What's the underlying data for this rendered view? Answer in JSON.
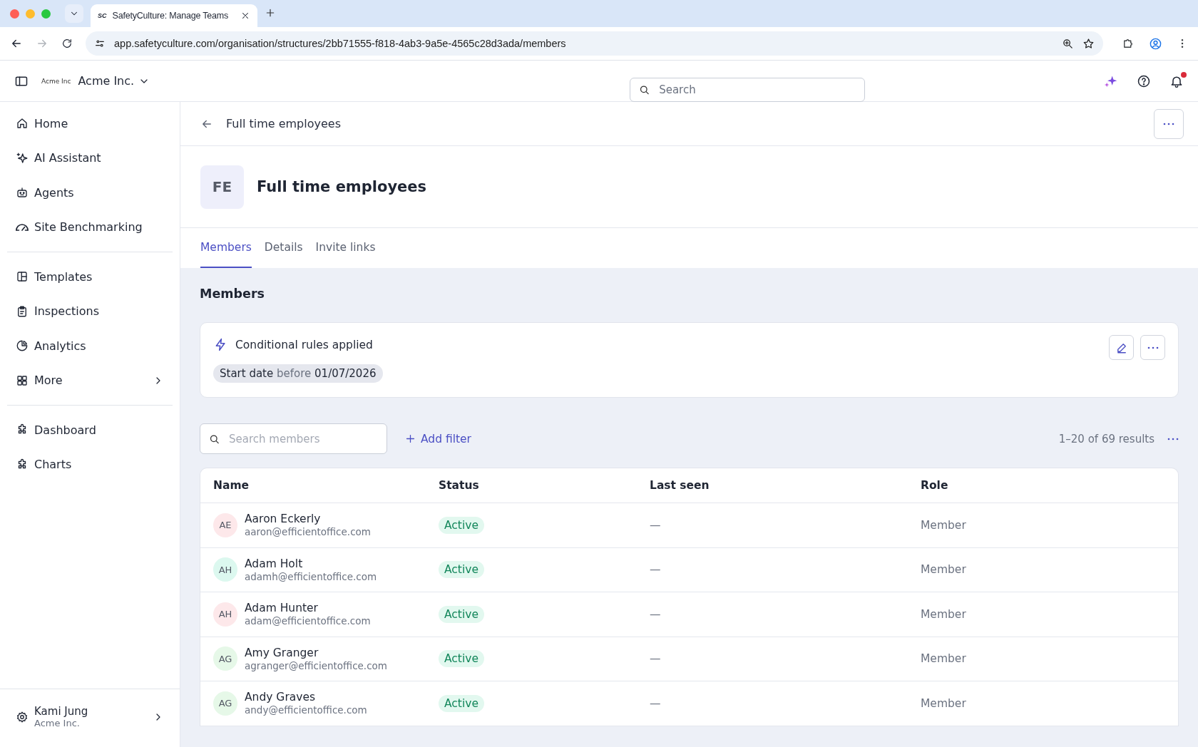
{
  "browser": {
    "tab_title": "SafetyCulture: Manage Teams",
    "tab_favicon": "SC",
    "url": "app.safetyculture.com/organisation/structures/2bb71555-f818-4ab3-9a5e-4565c28d3ada/members"
  },
  "header": {
    "logo_text": "Acme Inc",
    "org": "Acme Inc.",
    "search_placeholder": "Search",
    "notification": true
  },
  "sidebar": {
    "groups": [
      [
        {
          "label": "Home"
        },
        {
          "label": "AI Assistant"
        },
        {
          "label": "Agents"
        },
        {
          "label": "Site Benchmarking"
        }
      ],
      [
        {
          "label": "Templates"
        },
        {
          "label": "Inspections"
        },
        {
          "label": "Analytics"
        },
        {
          "label": "More",
          "chevron": true
        }
      ],
      [
        {
          "label": "Dashboard"
        },
        {
          "label": "Charts"
        }
      ]
    ],
    "user": {
      "name": "Kami Jung",
      "org": "Acme Inc."
    }
  },
  "breadcrumb": "Full time employees",
  "group": {
    "initials": "FE",
    "title": "Full time employees"
  },
  "tabs": [
    {
      "label": "Members",
      "selected": true
    },
    {
      "label": "Details",
      "selected": false
    },
    {
      "label": "Invite links",
      "selected": false
    }
  ],
  "section_title": "Members",
  "rules": {
    "title": "Conditional rules applied",
    "chip": "**Start date** before **01/07/2026**"
  },
  "toolbar": {
    "search_placeholder": "Search members",
    "add_filter": "Add filter",
    "results": "1–20 of 69 results"
  },
  "table": {
    "columns": [
      "Name",
      "Status",
      "Last seen",
      "Role"
    ],
    "rows": [
      {
        "initials": "AE",
        "color": "#fde8ea",
        "name": "Aaron Eckerly",
        "email": "aaron@efficientoffice.com",
        "status": "Active",
        "last_seen": "—",
        "role": "Member"
      },
      {
        "initials": "AH",
        "color": "#dcf8ef",
        "name": "Adam Holt",
        "email": "adamh@efficientoffice.com",
        "status": "Active",
        "last_seen": "—",
        "role": "Member"
      },
      {
        "initials": "AH",
        "color": "#fde8ea",
        "name": "Adam Hunter",
        "email": "adam@efficientoffice.com",
        "status": "Active",
        "last_seen": "—",
        "role": "Member"
      },
      {
        "initials": "AG",
        "color": "#e6f8e8",
        "name": "Amy Granger",
        "email": "agranger@efficientoffice.com",
        "status": "Active",
        "last_seen": "—",
        "role": "Member"
      },
      {
        "initials": "AG",
        "color": "#e6f8e8",
        "name": "Andy Graves",
        "email": "andy@efficientoffice.com",
        "status": "Active",
        "last_seen": "—",
        "role": "Member"
      }
    ]
  }
}
